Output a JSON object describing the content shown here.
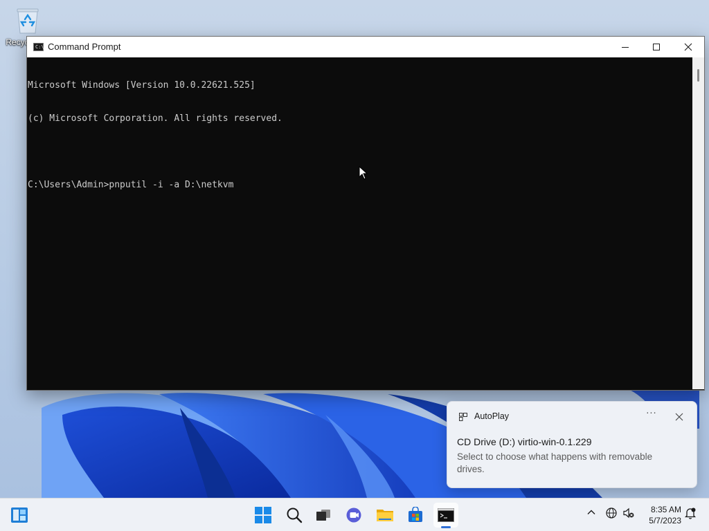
{
  "desktop": {
    "recycle_bin_label": "Recycle Bin"
  },
  "cmd_window": {
    "title": "Command Prompt",
    "lines": [
      "Microsoft Windows [Version 10.0.22621.525]",
      "(c) Microsoft Corporation. All rights reserved.",
      "",
      "C:\\Users\\Admin>pnputil -i -a D:\\netkvm"
    ],
    "background_color": "#0c0c0c",
    "text_color": "#cccccc"
  },
  "toast": {
    "app_name": "AutoPlay",
    "more_label": "···",
    "headline": "CD Drive (D:) virtio-win-0.1.229",
    "body": "Select to choose what happens with removable drives."
  },
  "taskbar": {
    "items": [
      {
        "name": "widgets",
        "icon": "widgets-icon"
      },
      {
        "name": "start",
        "icon": "windows-logo-icon"
      },
      {
        "name": "search",
        "icon": "search-icon"
      },
      {
        "name": "task-view",
        "icon": "task-view-icon"
      },
      {
        "name": "chat",
        "icon": "chat-icon"
      },
      {
        "name": "file-explorer",
        "icon": "folder-icon"
      },
      {
        "name": "microsoft-store",
        "icon": "store-icon"
      },
      {
        "name": "command-prompt",
        "icon": "terminal-icon",
        "active": true
      }
    ],
    "tray_icons": [
      "chevron-up-icon",
      "network-globe-icon",
      "speaker-muted-icon"
    ],
    "time": "8:35 AM",
    "date": "5/7/2023",
    "accent_color": "#2f6fd6"
  }
}
